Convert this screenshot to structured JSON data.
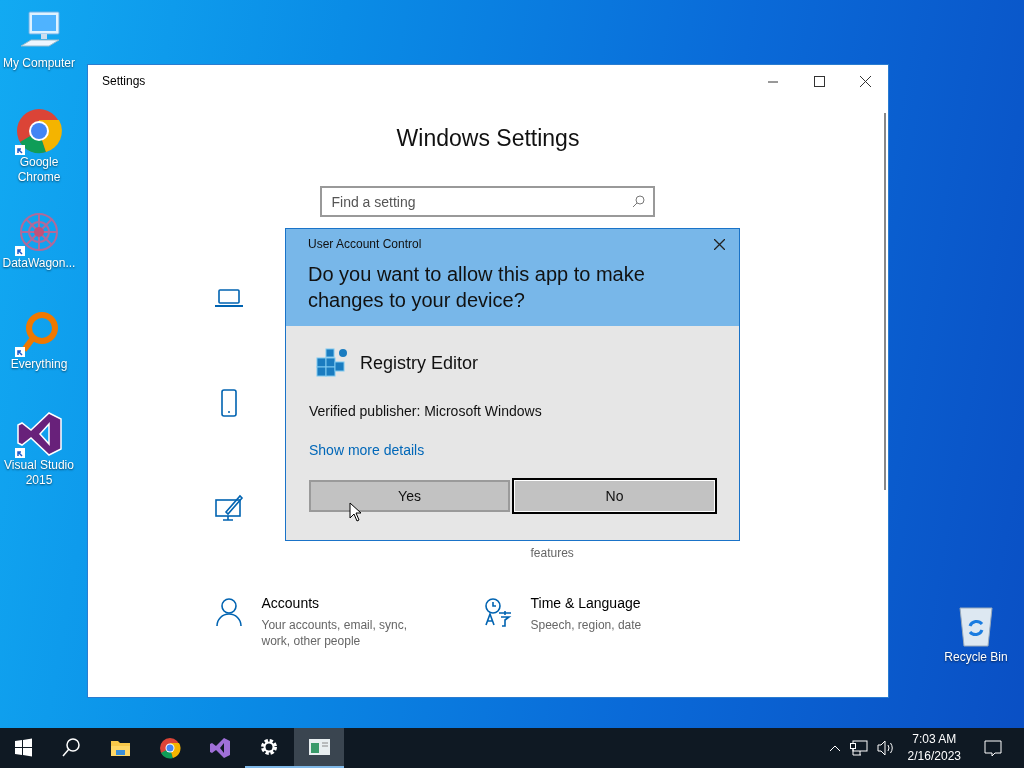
{
  "desktop_icons": [
    {
      "kind": "computer",
      "label": "My Computer",
      "shortcut": false
    },
    {
      "kind": "chrome",
      "label": "Google Chrome",
      "shortcut": true
    },
    {
      "kind": "datawagon",
      "label": "DataWagon...",
      "shortcut": true
    },
    {
      "kind": "everything",
      "label": "Everything",
      "shortcut": true
    },
    {
      "kind": "vs",
      "label": "Visual Studio 2015",
      "shortcut": true
    },
    {
      "kind": "recycle",
      "label": "Recycle Bin",
      "shortcut": false
    }
  ],
  "settings_window": {
    "title": "Settings",
    "heading": "Windows Settings",
    "search": {
      "placeholder": "Find a setting"
    },
    "category_rows": [
      {
        "items": [
          {
            "kind": "laptop"
          }
        ]
      },
      {
        "items": [
          {
            "kind": "phone"
          }
        ]
      },
      {
        "items": [
          {
            "kind": "paint"
          },
          {
            "description": "features"
          }
        ]
      },
      {
        "items": [
          {
            "kind": "person",
            "title": "Accounts",
            "description": "Your accounts, email, sync, work, other people"
          },
          {
            "kind": "language",
            "title": "Time & Language",
            "description": "Speech, region, date"
          }
        ]
      }
    ]
  },
  "uac_dialog": {
    "title": "User Account Control",
    "question": "Do you want to allow this app to make changes to your device?",
    "app_name": "Registry Editor",
    "publisher": "Verified publisher: Microsoft Windows",
    "details_link": "Show more details",
    "buttons": [
      {
        "label": "Yes",
        "focused": false
      },
      {
        "label": "No",
        "focused": true
      }
    ]
  },
  "taskbar": {
    "items": [
      {
        "kind": "start",
        "running": false,
        "selected": false
      },
      {
        "kind": "search",
        "running": false,
        "selected": false
      },
      {
        "kind": "explorer",
        "running": false,
        "selected": false
      },
      {
        "kind": "chrome",
        "running": false,
        "selected": false
      },
      {
        "kind": "vs",
        "running": false,
        "selected": false
      },
      {
        "kind": "settings",
        "running": true,
        "selected": false
      },
      {
        "kind": "regedit",
        "running": true,
        "selected": true
      }
    ],
    "time": "7:03 AM",
    "date": "2/16/2023"
  }
}
